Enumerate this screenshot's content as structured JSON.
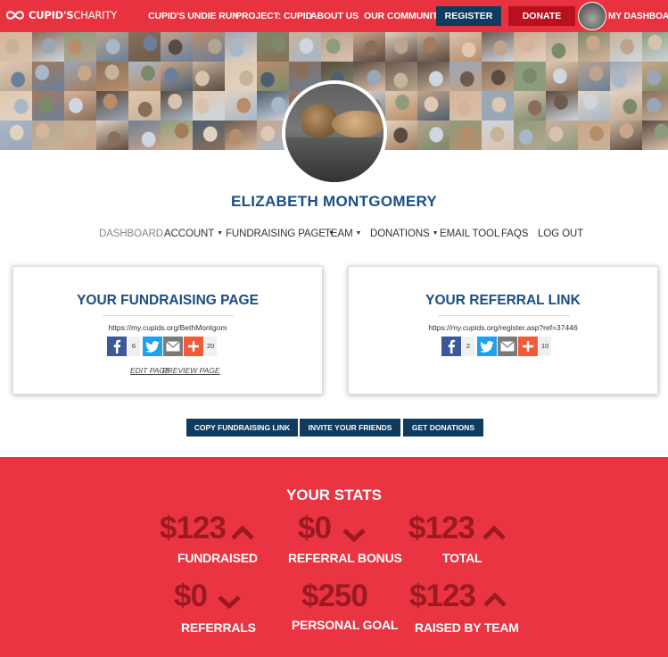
{
  "nav": {
    "logo": {
      "bold": "CUPID'S",
      "light": "CHARITY"
    },
    "links": [
      "CUPID'S UNDIE RUN",
      "PROJECT: CUPID",
      "ABOUT US",
      "OUR COMMUNITY"
    ],
    "register_label": "REGISTER",
    "donate_label": "DONATE",
    "dashboard_label": "MY DASHBOARD"
  },
  "colors": {
    "brand_red": "#e8323f",
    "navy": "#0f3b5f",
    "donate_red": "#b8101d",
    "title_blue": "#184e86",
    "stat_dark": "#9b1a22"
  },
  "profile": {
    "name": "ELIZABETH MONTGOMERY"
  },
  "subnav": {
    "items": [
      {
        "label": "DASHBOARD",
        "dropdown": false,
        "active": true
      },
      {
        "label": "ACCOUNT",
        "dropdown": true
      },
      {
        "label": "FUNDRAISING PAGE",
        "dropdown": true
      },
      {
        "label": "TEAM",
        "dropdown": true
      },
      {
        "label": "DONATIONS",
        "dropdown": true
      },
      {
        "label": "EMAIL TOOL",
        "dropdown": false
      },
      {
        "label": "FAQS",
        "dropdown": false
      },
      {
        "label": "LOG OUT",
        "dropdown": false
      }
    ]
  },
  "fundraising_card": {
    "title": "YOUR FUNDRAISING PAGE",
    "url": "https://my.cupids.org/BethMontgom",
    "fb_count": "6",
    "share_count": "20",
    "edit_label": "EDIT PAGE",
    "preview_label": "PREVIEW PAGE"
  },
  "referral_card": {
    "title": "YOUR REFERRAL LINK",
    "url": "https://my.cupids.org/register.asp?ref=37446",
    "fb_count": "2",
    "share_count": "10"
  },
  "actions": {
    "copy_label": "COPY FUNDRAISING LINK",
    "invite_label": "INVITE YOUR FRIENDS",
    "donations_label": "GET DONATIONS"
  },
  "stats": {
    "title": "YOUR STATS",
    "items": [
      {
        "value": "$123",
        "label": "FUNDRAISED",
        "trend": "up"
      },
      {
        "value": "$0",
        "label": "REFERRAL BONUS",
        "trend": "down"
      },
      {
        "value": "$123",
        "label": "TOTAL",
        "trend": "up"
      },
      {
        "value": "$0",
        "label": "REFERRALS",
        "trend": "down"
      },
      {
        "value": "$250",
        "label": "PERSONAL GOAL",
        "trend": "none"
      },
      {
        "value": "$123",
        "label": "RAISED BY TEAM",
        "trend": "up"
      }
    ]
  },
  "icons": {
    "facebook": "facebook-icon",
    "twitter": "twitter-icon",
    "email": "email-icon",
    "share": "plus-icon",
    "up": "chevron-up-icon",
    "down": "chevron-down-icon"
  }
}
